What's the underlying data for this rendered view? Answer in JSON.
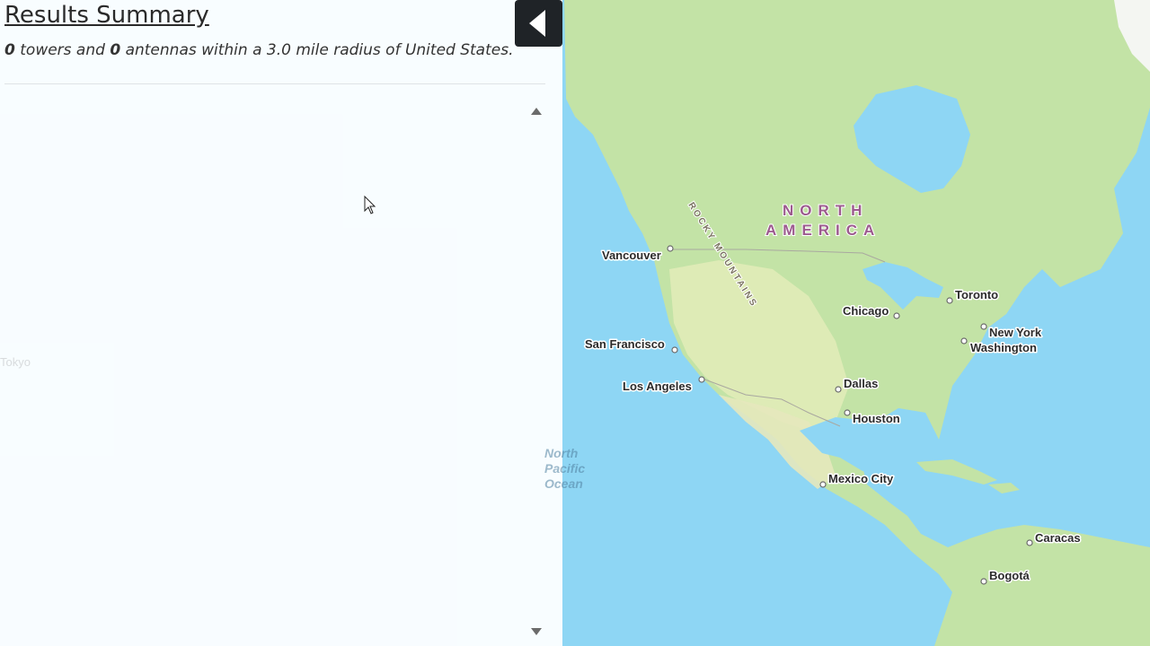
{
  "panel": {
    "title": "Results Summary",
    "summary": {
      "towers_count": "0",
      "towers_text": " towers and ",
      "antennas_count": "0",
      "antennas_text": " antennas within a 3.0 mile radius of United States."
    },
    "scroll_up_icon": "triangle-up-icon",
    "scroll_down_icon": "triangle-down-icon",
    "ghost_labels": {
      "tokyo": "Tokyo"
    }
  },
  "collapse_button": {
    "icon": "caret-left-icon"
  },
  "map": {
    "colors": {
      "ocean": "#8ed6f4",
      "land": "#c3e3a6",
      "land_dry": "#e6e8b8",
      "lake": "#8ed6f4"
    },
    "region_label": [
      "NORTH",
      "AMERICA"
    ],
    "range_label": "ROCKY MOUNTAINS",
    "ocean_label": [
      "North",
      "Pacific",
      "Ocean"
    ],
    "cities": {
      "vancouver": "Vancouver",
      "san_francisco": "San Francisco",
      "los_angeles": "Los Angeles",
      "chicago": "Chicago",
      "toronto": "Toronto",
      "new_york": "New York",
      "washington": "Washington",
      "dallas": "Dallas",
      "houston": "Houston",
      "mexico_city": "Mexico City",
      "caracas": "Caracas",
      "bogota": "Bogotá"
    }
  }
}
